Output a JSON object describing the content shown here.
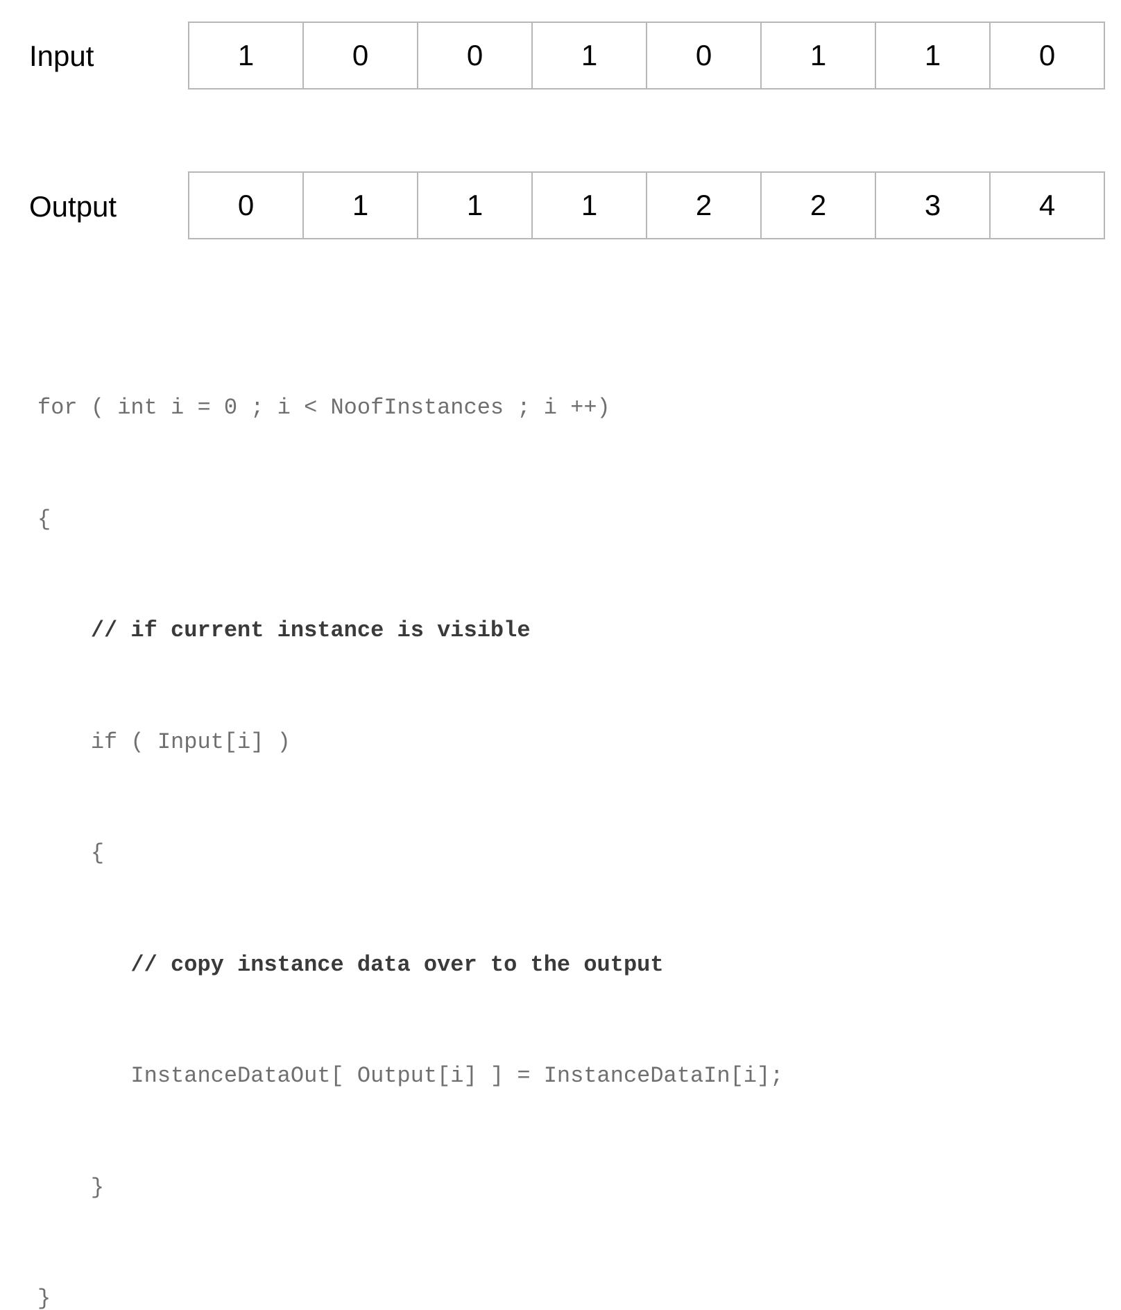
{
  "input": {
    "label": "Input",
    "values": [
      "1",
      "0",
      "0",
      "1",
      "0",
      "1",
      "1",
      "0"
    ]
  },
  "output": {
    "label": "Output",
    "values": [
      "0",
      "1",
      "1",
      "1",
      "2",
      "2",
      "3",
      "4"
    ]
  },
  "code": {
    "lines": [
      {
        "text": "for ( int i = 0 ; i < NoofInstances ; i ++)",
        "comment": false
      },
      {
        "text": "{",
        "comment": false
      },
      {
        "text": "    // if current instance is visible",
        "comment": true
      },
      {
        "text": "    if ( Input[i] )",
        "comment": false
      },
      {
        "text": "    {",
        "comment": false
      },
      {
        "text": "       // copy instance data over to the output",
        "comment": true
      },
      {
        "text": "       InstanceDataOut[ Output[i] ] = InstanceDataIn[i];",
        "comment": false
      },
      {
        "text": "    }",
        "comment": false
      },
      {
        "text": "}",
        "comment": false
      }
    ]
  }
}
